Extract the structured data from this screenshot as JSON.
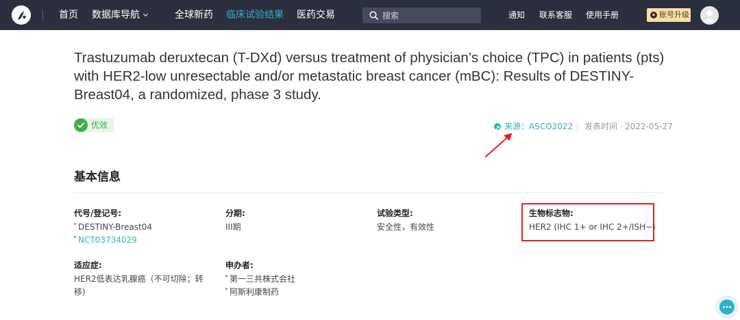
{
  "nav": {
    "items": [
      {
        "label": "首页"
      },
      {
        "label": "数据库导航"
      },
      {
        "label": "全球新药"
      },
      {
        "label": "临床试验结果"
      },
      {
        "label": "医药交易"
      }
    ],
    "active_index": 3,
    "search": {
      "placeholder": "搜索"
    },
    "util_links": [
      "通知",
      "联系客服",
      "使用手册"
    ],
    "upgrade_label": "账号升级"
  },
  "article": {
    "title": "Trastuzumab deruxtecan (T-DXd) versus treatment of physician’s choice (TPC) in patients (pts) with HER2-low unresectable and/or metastatic breast cancer (mBC): Results of DESTINY-Breast04, a randomized, phase 3 study.",
    "badge": "优效",
    "source_label": "来源：",
    "source_value": "ASCO2022",
    "date_label": "发表时间 ·",
    "date_value": "2022-05-27"
  },
  "basic_info": {
    "heading": "基本信息",
    "fields": {
      "id": {
        "label": "代号/登记号:",
        "values": [
          "DESTINY-Breast04",
          "NCT03734029"
        ]
      },
      "phase": {
        "label": "分期:",
        "value": "III期"
      },
      "trial_type": {
        "label": "试验类型:",
        "value": "安全性，有效性"
      },
      "biomarker": {
        "label": "生物标志物:",
        "value": "HER2 (IHC 1+ or IHC 2+/ISH−)"
      },
      "indication": {
        "label": "适应症:",
        "lines": [
          "HER2低表达乳腺癌（不可切除；转",
          "移)"
        ]
      },
      "sponsor": {
        "label": "申办者:",
        "values": [
          "第一三共株式会社",
          "阿斯利康制药"
        ]
      }
    }
  },
  "colors": {
    "nav_bg": "#2c2f3e",
    "accent": "#2fb1c9",
    "badge_green": "#3dae4a",
    "annotation_red": "#e02020"
  }
}
